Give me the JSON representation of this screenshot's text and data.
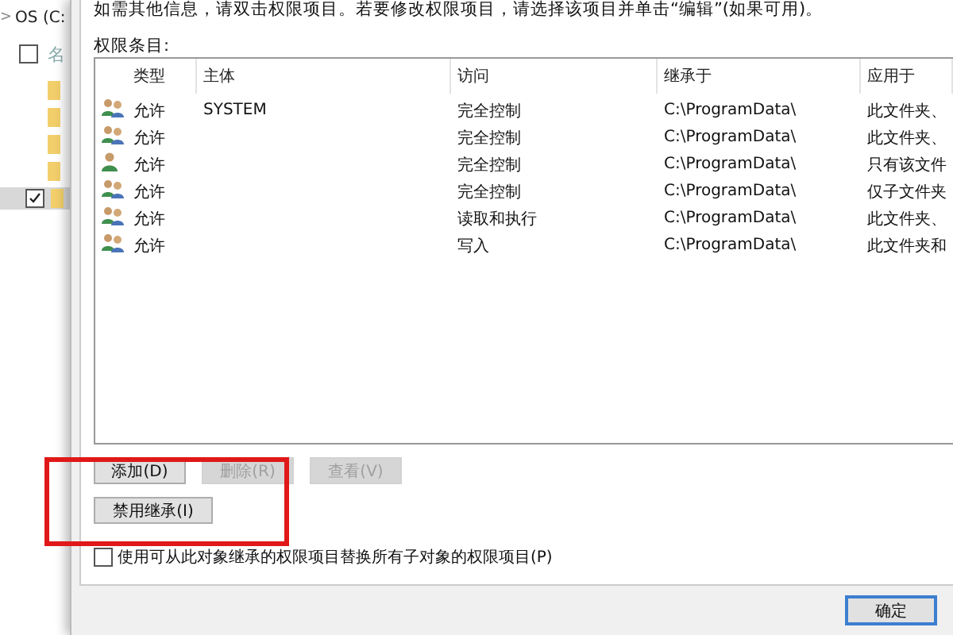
{
  "explorer": {
    "breadcrumb_chevron": ">",
    "breadcrumb": "OS (C:",
    "header_checkbox": {
      "checked": false
    },
    "name_header_fragment": "名",
    "folders": [
      {
        "checked": false
      },
      {
        "checked": false
      },
      {
        "checked": false
      },
      {
        "checked": false
      },
      {
        "checked": true
      }
    ]
  },
  "dialog": {
    "info": "如需其他信息，请双击权限项目。若要修改权限项目，请选择该项目并单击“编辑”(如果可用)。",
    "entries_label": "权限条目:",
    "table": {
      "columns": [
        "类型",
        "主体",
        "访问",
        "继承于",
        "应用于"
      ],
      "rows": [
        {
          "kind": "group",
          "type": "允许",
          "principal": "SYSTEM",
          "access": "完全控制",
          "inherited_from": "C:\\ProgramData\\",
          "applies_to": "此文件夹、"
        },
        {
          "kind": "group",
          "type": "允许",
          "access": "完全控制",
          "inherited_from": "C:\\ProgramData\\",
          "applies_to": "此文件夹、"
        },
        {
          "kind": "user",
          "type": "允许",
          "access": "完全控制",
          "inherited_from": "C:\\ProgramData\\",
          "applies_to": "只有该文件"
        },
        {
          "kind": "group",
          "type": "允许",
          "access": "完全控制",
          "inherited_from": "C:\\ProgramData\\",
          "applies_to": "仅子文件夹"
        },
        {
          "kind": "group",
          "type": "允许",
          "access": "读取和执行",
          "inherited_from": "C:\\ProgramData\\",
          "applies_to": "此文件夹、"
        },
        {
          "kind": "group",
          "type": "允许",
          "access": "写入",
          "inherited_from": "C:\\ProgramData\\",
          "applies_to": "此文件夹和"
        }
      ]
    },
    "buttons": [
      {
        "label": "添加(D)",
        "disabled": false
      },
      {
        "label": "删除(R)",
        "disabled": true
      },
      {
        "label": "查看(V)",
        "disabled": true
      }
    ],
    "disable_inheritance": {
      "label": "禁用继承(I)",
      "disabled": false
    },
    "replace_checkbox": {
      "label": "使用可从此对象继承的权限项目替换所有子对象的权限项目(P)",
      "checked": false
    },
    "ok_button": "确定"
  }
}
